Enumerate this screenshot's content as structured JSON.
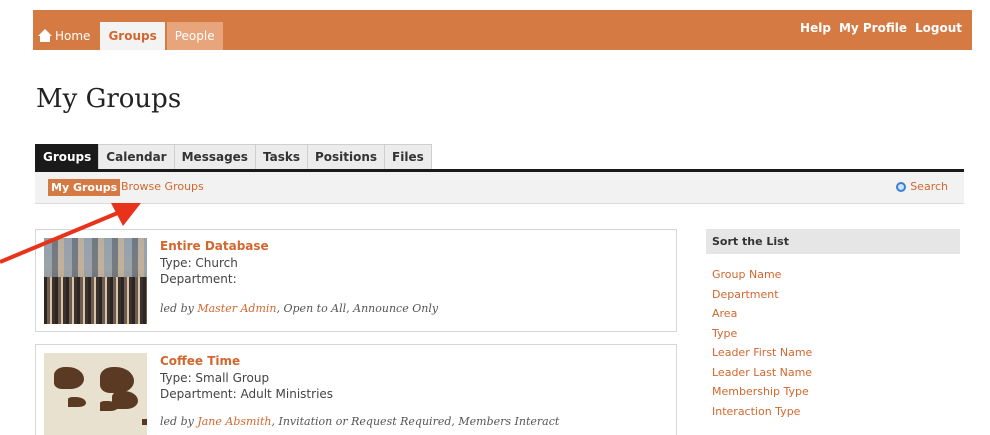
{
  "topnav": {
    "home": "Home",
    "groups": "Groups",
    "people": "People",
    "help": "Help",
    "profile": "My Profile",
    "logout": "Logout"
  },
  "page": {
    "title": "My Groups"
  },
  "tabs": [
    "Groups",
    "Calendar",
    "Messages",
    "Tasks",
    "Positions",
    "Files"
  ],
  "subnav": {
    "my_groups": "My Groups",
    "browse": "Browse Groups",
    "search": "Search"
  },
  "groups": [
    {
      "name": "Entire Database",
      "type": "Type: Church",
      "department": "Department:",
      "led_prefix": "led by",
      "leader": "Master Admin",
      "led_suffix": ", Open to All, Announce Only"
    },
    {
      "name": "Coffee Time",
      "type": "Type: Small Group",
      "department": "Department: Adult Ministries",
      "led_prefix": "led by",
      "leader": "Jane Absmith",
      "led_suffix": ", Invitation or Request Required, Members Interact"
    }
  ],
  "sort": {
    "title": "Sort the List",
    "options": [
      "Group Name",
      "Department",
      "Area",
      "Type",
      "Leader First Name",
      "Leader Last Name",
      "Membership Type",
      "Interaction Type"
    ]
  },
  "colors": {
    "accent": "#d57a43",
    "link": "#d2672e",
    "tab_active": "#1a1a1a",
    "arrow": "#e8321a"
  }
}
